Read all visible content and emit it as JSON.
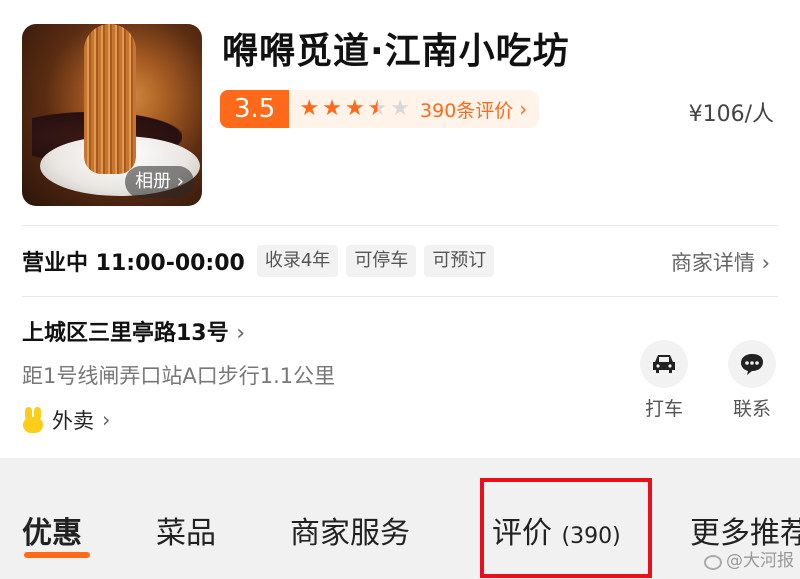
{
  "shop": {
    "name": "嘚嘚觅道·江南小吃坊",
    "album_label": "相册",
    "rating": {
      "score": "3.5",
      "stars": 3.5,
      "review_count_label": "390条评价"
    },
    "price": "¥106/人"
  },
  "info": {
    "status_hours": "营业中 11:00-00:00",
    "tags": [
      "收录4年",
      "可停车",
      "可预订"
    ],
    "merchant_detail": "商家详情",
    "address": "上城区三里亭路13号",
    "distance": "距1号线闸弄口站A口步行1.1公里",
    "delivery": "外卖"
  },
  "actions": [
    {
      "label": "打车",
      "icon": "car-icon"
    },
    {
      "label": "联系",
      "icon": "chat-icon"
    }
  ],
  "tabs": [
    {
      "label": "优惠",
      "count": ""
    },
    {
      "label": "菜品",
      "count": ""
    },
    {
      "label": "商家服务",
      "count": ""
    },
    {
      "label": "评价",
      "count": "(390)"
    },
    {
      "label": "更多推荐",
      "count": ""
    }
  ],
  "watermark": "@大河报",
  "colors": {
    "accent": "#ff6a1a",
    "highlight": "#e8101a"
  }
}
